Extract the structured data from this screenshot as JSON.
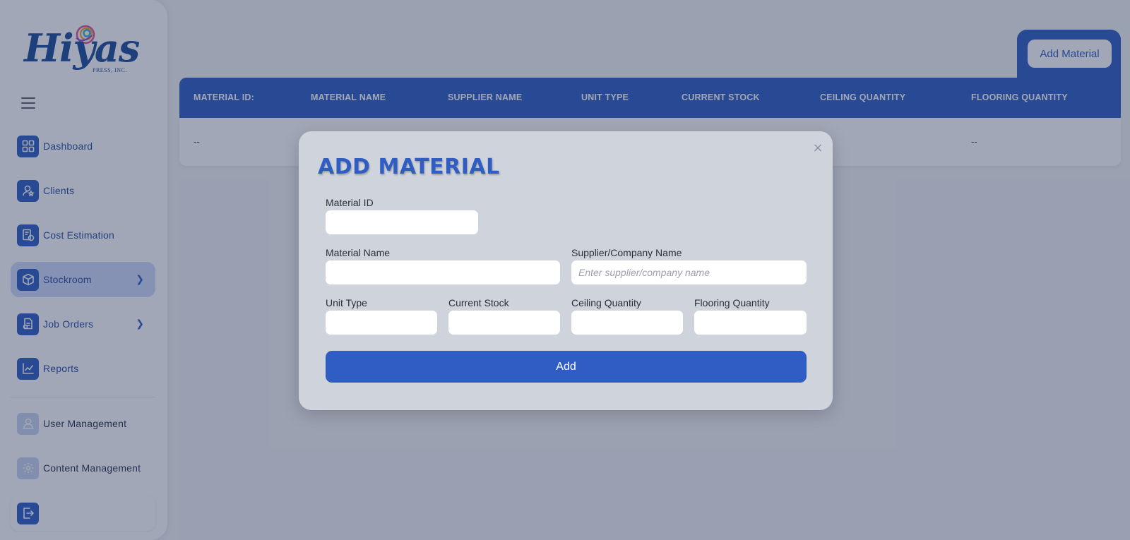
{
  "brand": {
    "logo_text": "Hiyas",
    "logo_subtext": "PRESS, INC."
  },
  "sidebar": {
    "items": [
      {
        "label": "Dashboard",
        "icon": "dashboard-icon"
      },
      {
        "label": "Clients",
        "icon": "clients-icon"
      },
      {
        "label": "Cost Estimation",
        "icon": "cost-estimation-icon"
      },
      {
        "label": "Stockroom",
        "icon": "box-icon",
        "active": true
      },
      {
        "label": "Job Orders",
        "icon": "job-orders-icon"
      },
      {
        "label": "Reports",
        "icon": "chart-line-icon"
      },
      {
        "label": "User Management",
        "icon": "user-icon"
      },
      {
        "label": "Content Management",
        "icon": "gear-icon"
      }
    ],
    "logout_label": "LOGOUT"
  },
  "toolbar": {
    "add_material_label": "Add Material"
  },
  "table": {
    "headers": [
      "MATERIAL ID:",
      "MATERIAL NAME",
      "SUPPLIER NAME",
      "UNIT TYPE",
      "CURRENT STOCK",
      "CEILING QUANTITY",
      "FLOORING QUANTITY"
    ],
    "rows": [
      [
        "--",
        "",
        "",
        "",
        "",
        "",
        "--"
      ]
    ]
  },
  "modal": {
    "title": "ADD MATERIAL",
    "close_glyph": "×",
    "fields": {
      "material_id": {
        "label": "Material ID",
        "value": "",
        "placeholder": ""
      },
      "material_name": {
        "label": "Material Name",
        "value": "",
        "placeholder": ""
      },
      "supplier": {
        "label": "Supplier/Company Name",
        "value": "",
        "placeholder": "Enter supplier/company name"
      },
      "unit_type": {
        "label": "Unit Type",
        "value": "",
        "placeholder": ""
      },
      "current_stock": {
        "label": "Current Stock",
        "value": "",
        "placeholder": ""
      },
      "ceiling_quantity": {
        "label": "Ceiling Quantity",
        "value": "",
        "placeholder": ""
      },
      "flooring_quantity": {
        "label": "Flooring Quantity",
        "value": "",
        "placeholder": ""
      }
    },
    "submit_label": "Add"
  },
  "colors": {
    "accent": "#2f5dc4",
    "active_nav_bg": "#cfdbfb",
    "overlay": "rgba(32,45,82,0.42)",
    "modal_bg": "#cfd3dc"
  }
}
